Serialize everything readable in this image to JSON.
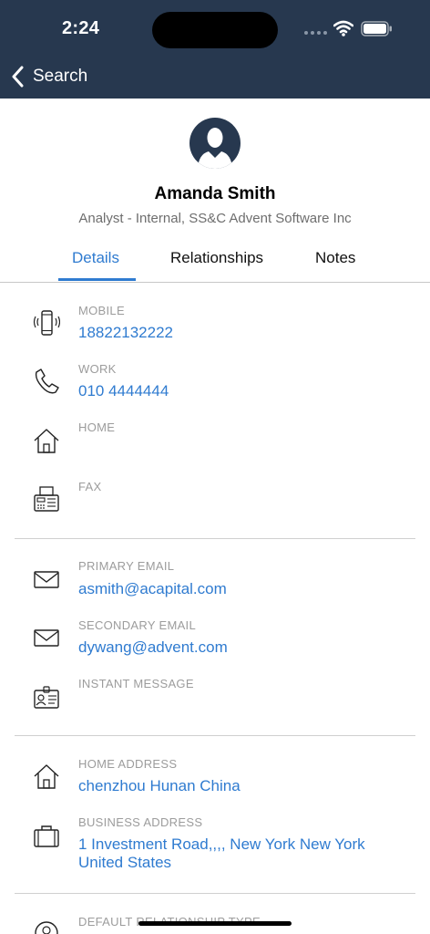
{
  "status_bar": {
    "time": "2:24"
  },
  "nav": {
    "back_label": "Search"
  },
  "profile": {
    "name": "Amanda Smith",
    "title": "Analyst - Internal, SS&C Advent Software Inc"
  },
  "tabs": [
    {
      "label": "Details",
      "active": true
    },
    {
      "label": "Relationships",
      "active": false
    },
    {
      "label": "Notes",
      "active": false
    }
  ],
  "phone": {
    "mobile": {
      "label": "MOBILE",
      "value": "18822132222",
      "icon": "mobile-phone-icon"
    },
    "work": {
      "label": "WORK",
      "value": "010 4444444",
      "icon": "phone-icon"
    },
    "home": {
      "label": "HOME",
      "value": "",
      "icon": "home-icon"
    },
    "fax": {
      "label": "FAX",
      "value": "",
      "icon": "fax-icon"
    }
  },
  "email": {
    "primary": {
      "label": "PRIMARY EMAIL",
      "value": "asmith@acapital.com",
      "icon": "envelope-icon"
    },
    "secondary": {
      "label": "SECONDARY EMAIL",
      "value": "dywang@advent.com",
      "icon": "envelope-icon"
    },
    "im": {
      "label": "INSTANT MESSAGE",
      "value": "",
      "icon": "id-badge-icon"
    }
  },
  "address": {
    "home": {
      "label": "HOME ADDRESS",
      "value": "chenzhou Hunan China",
      "icon": "home-icon"
    },
    "business": {
      "label": "BUSINESS ADDRESS",
      "value": "1 Investment Road,,,, New York New York United States",
      "icon": "briefcase-icon"
    }
  },
  "relationship": {
    "label": "DEFAULT RELATIONSHIP TYPE"
  },
  "colors": {
    "header_bg": "#27384f",
    "accent": "#2f7bd0",
    "label_gray": "#9c9c9c"
  }
}
